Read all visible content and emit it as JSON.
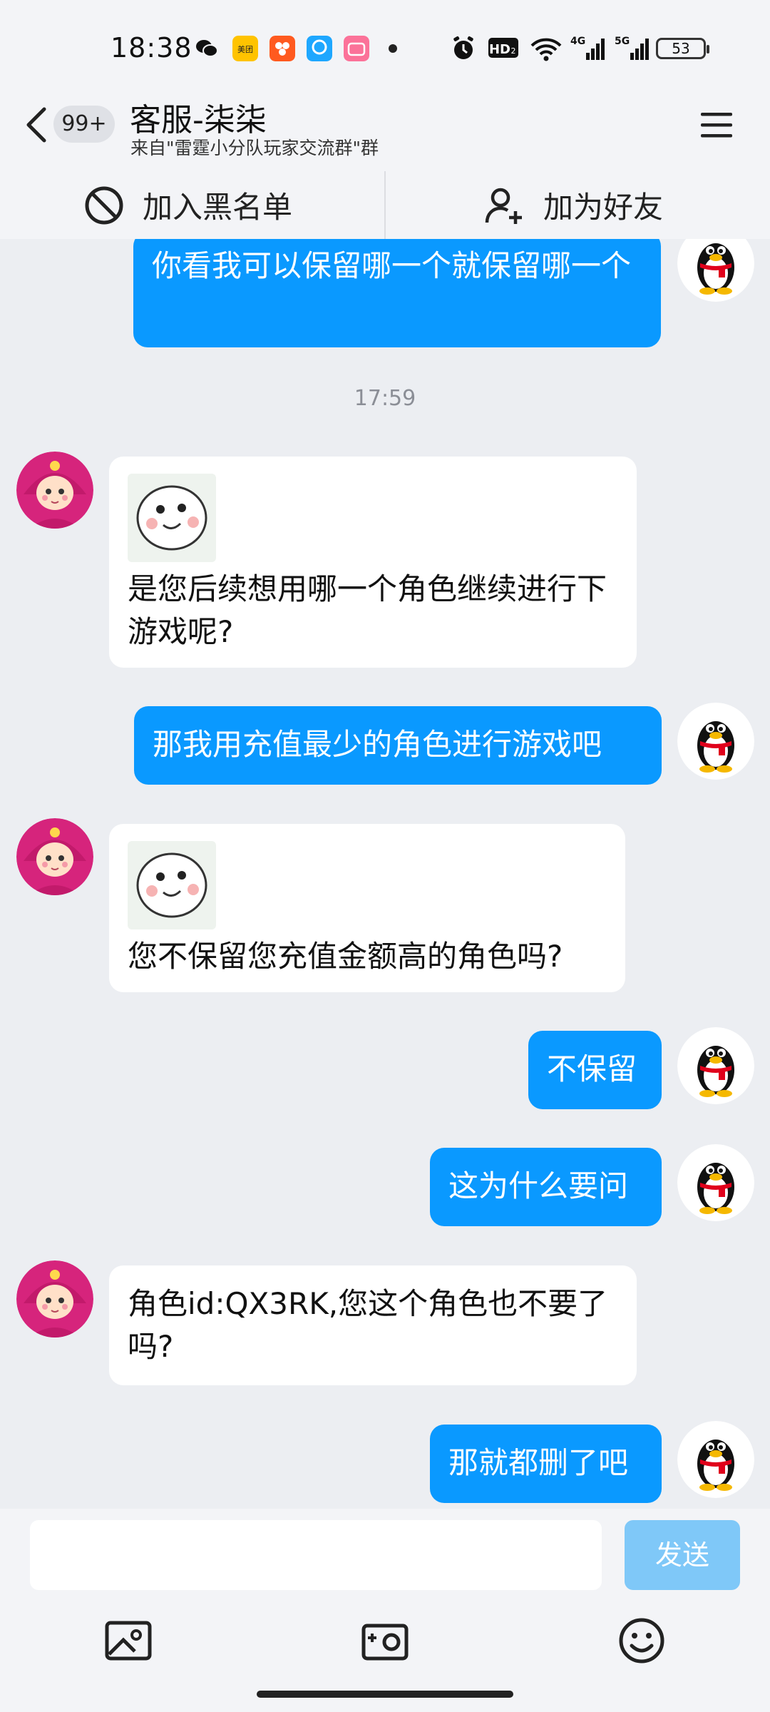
{
  "status_bar": {
    "time": "18:38",
    "battery": "53",
    "network": [
      "HD",
      "4G",
      "5G"
    ]
  },
  "header": {
    "unread_badge": "99+",
    "title": "客服-柒柒",
    "subtitle": "来自\"雷霆小分队玩家交流群\"群"
  },
  "actions": {
    "blacklist": "加入黑名单",
    "add_friend": "加为好友"
  },
  "chat": {
    "messages": [
      {
        "side": "out",
        "text": "你看我可以保留哪一个就保留哪一个"
      },
      {
        "type": "time",
        "text": "17:59"
      },
      {
        "side": "in",
        "text": "是您后续想用哪一个角色继续进行下游戏呢?",
        "sticker": true
      },
      {
        "side": "out",
        "text": "那我用充值最少的角色进行游戏吧"
      },
      {
        "side": "in",
        "text": "您不保留您充值金额高的角色吗?",
        "sticker": true
      },
      {
        "side": "out",
        "text": "不保留"
      },
      {
        "side": "out",
        "text": "这为什么要问"
      },
      {
        "side": "in",
        "text": "角色id:QX3RK,您这个角色也不要了吗?"
      },
      {
        "side": "out",
        "text": "那就都删了吧"
      }
    ]
  },
  "input": {
    "value": "",
    "placeholder": "",
    "send_label": "发送"
  },
  "colors": {
    "outgoing_bubble": "#0a99ff",
    "send_disabled": "#7fc8f8",
    "background": "#eceef2"
  },
  "icons": [
    "wechat-icon",
    "meituan-icon",
    "app-icon",
    "browser-icon",
    "bilibili-icon",
    "alarm-icon",
    "wifi-icon",
    "signal-icon",
    "block-icon",
    "add-friend-icon",
    "menu-icon",
    "image-icon",
    "camera-icon",
    "emoji-icon"
  ]
}
